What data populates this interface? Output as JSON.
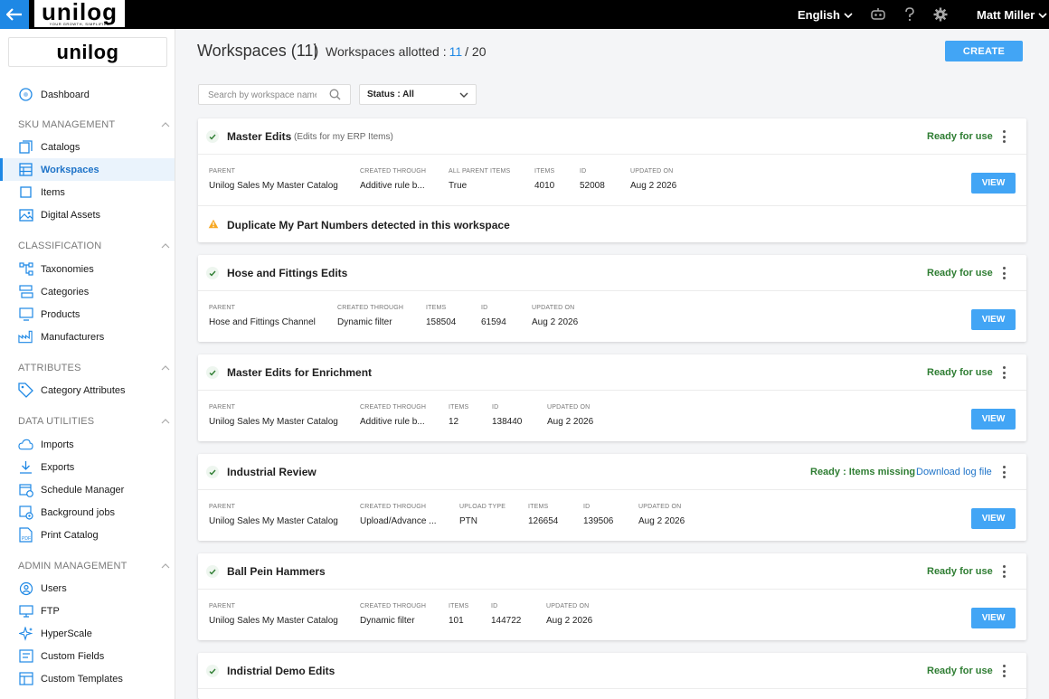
{
  "topbar": {
    "logo_word": "unilog",
    "logo_tagline": "YOUR GROWTH, SIMPLIFIED",
    "language": "English",
    "user_name": "Matt Miller"
  },
  "sidebar": {
    "logo": "unilog",
    "dashboard": "Dashboard",
    "sections": [
      {
        "title": "SKU MANAGEMENT",
        "items": [
          "Catalogs",
          "Workspaces",
          "Items",
          "Digital Assets"
        ]
      },
      {
        "title": "CLASSIFICATION",
        "items": [
          "Taxonomies",
          "Categories",
          "Products",
          "Manufacturers"
        ]
      },
      {
        "title": "ATTRIBUTES",
        "items": [
          "Category Attributes"
        ]
      },
      {
        "title": "DATA UTILITIES",
        "items": [
          "Imports",
          "Exports",
          "Schedule Manager",
          "Background jobs",
          "Print Catalog"
        ]
      },
      {
        "title": "ADMIN MANAGEMENT",
        "items": [
          "Users",
          "FTP",
          "HyperScale",
          "Custom Fields",
          "Custom Templates"
        ]
      }
    ]
  },
  "header": {
    "title": "Workspaces (11)",
    "allotted_label": "Workspaces allotted :",
    "allotted_used": "11",
    "allotted_total": "/ 20",
    "create_label": "CREATE"
  },
  "filters": {
    "search_placeholder": "Search by workspace name",
    "status_label": "Status : All"
  },
  "cards": [
    {
      "title": "Master Edits",
      "subtitle": "(Edits for my ERP Items)",
      "status": "Ready for use",
      "fields": [
        {
          "label": "PARENT",
          "value": "Unilog Sales My Master Catalog"
        },
        {
          "label": "CREATED THROUGH",
          "value": "Additive rule b..."
        },
        {
          "label": "ALL PARENT ITEMS",
          "value": "True"
        },
        {
          "label": "ITEMS",
          "value": "4010"
        },
        {
          "label": "ID",
          "value": "52008"
        },
        {
          "label": "UPDATED ON",
          "value": "Aug 2 2026"
        }
      ],
      "view_label": "VIEW",
      "warning": "Duplicate My Part Numbers detected in this workspace"
    },
    {
      "title": "Hose and Fittings Edits",
      "status": "Ready for use",
      "fields": [
        {
          "label": "PARENT",
          "value": "Hose and Fittings Channel"
        },
        {
          "label": "CREATED THROUGH",
          "value": "Dynamic filter"
        },
        {
          "label": "ITEMS",
          "value": "158504"
        },
        {
          "label": "ID",
          "value": "61594"
        },
        {
          "label": "UPDATED ON",
          "value": "Aug 2 2026"
        }
      ],
      "view_label": "VIEW"
    },
    {
      "title": "Master Edits for Enrichment",
      "status": "Ready for use",
      "fields": [
        {
          "label": "PARENT",
          "value": "Unilog Sales My Master Catalog"
        },
        {
          "label": "CREATED THROUGH",
          "value": "Additive rule b..."
        },
        {
          "label": "ITEMS",
          "value": "12"
        },
        {
          "label": "ID",
          "value": "138440"
        },
        {
          "label": "UPDATED ON",
          "value": "Aug 2 2026"
        }
      ],
      "view_label": "VIEW"
    },
    {
      "title": "Industrial Review",
      "status": "Ready : Items missing",
      "download_log": "Download log file",
      "fields": [
        {
          "label": "PARENT",
          "value": "Unilog Sales My Master Catalog"
        },
        {
          "label": "CREATED THROUGH",
          "value": "Upload/Advance ..."
        },
        {
          "label": "UPLOAD TYPE",
          "value": "PTN"
        },
        {
          "label": "ITEMS",
          "value": "126654"
        },
        {
          "label": "ID",
          "value": "139506"
        },
        {
          "label": "UPDATED ON",
          "value": "Aug 2 2026"
        }
      ],
      "view_label": "VIEW"
    },
    {
      "title": "Ball Pein Hammers",
      "status": "Ready for use",
      "fields": [
        {
          "label": "PARENT",
          "value": "Unilog Sales My Master Catalog"
        },
        {
          "label": "CREATED THROUGH",
          "value": "Dynamic filter"
        },
        {
          "label": "ITEMS",
          "value": "101"
        },
        {
          "label": "ID",
          "value": "144722"
        },
        {
          "label": "UPDATED ON",
          "value": "Aug 2 2026"
        }
      ],
      "view_label": "VIEW"
    },
    {
      "title": "Indistrial Demo Edits",
      "status": "Ready for use"
    }
  ],
  "colors": {
    "accent": "#1e88e5",
    "button": "#42a5f5",
    "ready": "#2e7d32",
    "topbar": "#000000"
  },
  "icons": [
    "back-arrow-icon",
    "chevron-down-icon",
    "robot-icon",
    "help-icon",
    "gear-icon",
    "search-icon",
    "check-icon",
    "warning-icon",
    "kebab-menu-icon"
  ]
}
